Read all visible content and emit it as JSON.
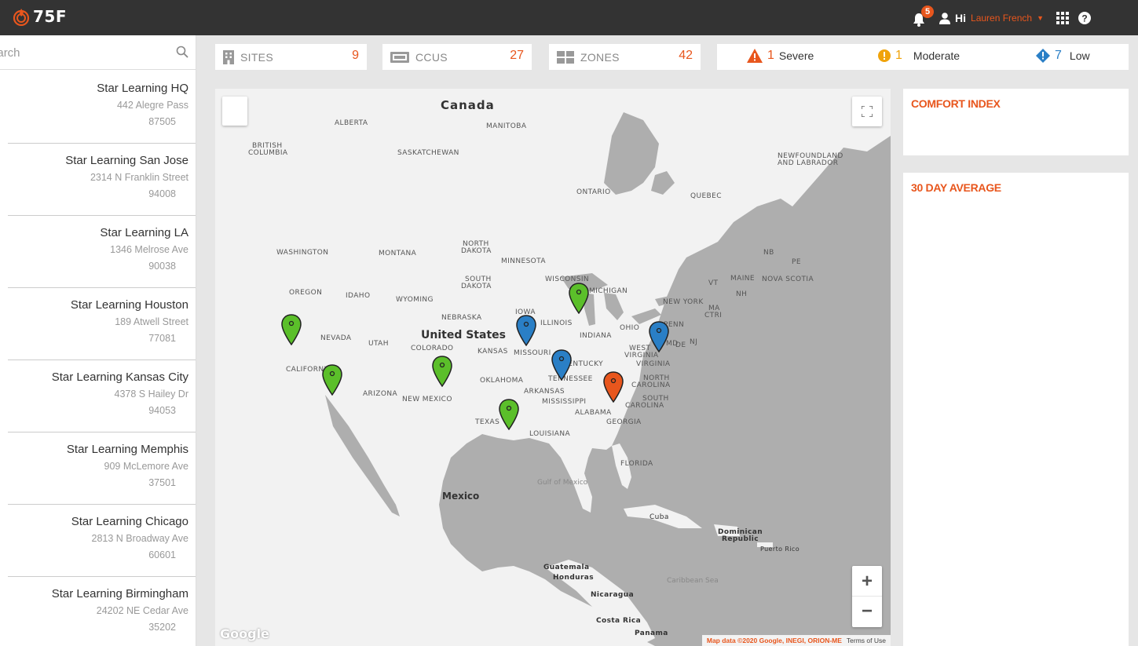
{
  "topbar": {
    "logo_text": "75F",
    "notification_count": "5",
    "greeting": "Hi",
    "user_name": "Lauren French",
    "icons": [
      "bell-icon",
      "user-icon",
      "grid-icon",
      "help-icon"
    ]
  },
  "sidebar": {
    "search_text": "Search",
    "sites": [
      {
        "name": "Star Learning HQ",
        "address": "442  Alegre Pass",
        "zip": "87505"
      },
      {
        "name": "Star Learning San Jose",
        "address": "2314 N  Franklin Street",
        "zip": "94008"
      },
      {
        "name": "Star Learning LA",
        "address": "1346  Melrose Ave",
        "zip": "90038"
      },
      {
        "name": "Star Learning Houston",
        "address": "189  Atwell Street",
        "zip": "77081"
      },
      {
        "name": "Star Learning Kansas City",
        "address": "4378 S  Hailey Dr",
        "zip": "94053"
      },
      {
        "name": "Star Learning Memphis",
        "address": "909 McLemore Ave",
        "zip": "37501"
      },
      {
        "name": "Star Learning Chicago",
        "address": "2813 N Broadway Ave",
        "zip": "60601"
      },
      {
        "name": "Star Learning Birmingham",
        "address": "24202 NE Cedar Ave",
        "zip": "35202"
      }
    ]
  },
  "stats": {
    "sites": {
      "label": "SITES",
      "value": "9"
    },
    "ccus": {
      "label": "CCUS",
      "value": "27"
    },
    "zones": {
      "label": "ZONES",
      "value": "42"
    }
  },
  "alerts": {
    "severe": {
      "count": "1",
      "label": "Severe"
    },
    "moderate": {
      "count": "1",
      "label": "Moderate"
    },
    "low": {
      "count": "7",
      "label": "Low"
    }
  },
  "map": {
    "labels": {
      "canada": "Canada",
      "alberta": "ALBERTA",
      "manitoba": "MANITOBA",
      "british_columbia_1": "BRITISH",
      "british_columbia_2": "COLUMBIA",
      "saskatchewan": "SASKATCHEWAN",
      "newfoundland_1": "NEWFOUNDLAND",
      "newfoundland_2": "AND LABRADOR",
      "ontario": "ONTARIO",
      "quebec": "QUEBEC",
      "washington": "WASHINGTON",
      "montana": "MONTANA",
      "north_dakota_1": "NORTH",
      "north_dakota_2": "DAKOTA",
      "minnesota": "MINNESOTA",
      "nb": "NB",
      "pe": "PE",
      "maine": "MAINE",
      "nova_scotia": "NOVA SCOTIA",
      "vt": "VT",
      "nh": "NH",
      "oregon": "OREGON",
      "idaho": "IDAHO",
      "wyoming": "WYOMING",
      "south_dakota_1": "SOUTH",
      "south_dakota_2": "DAKOTA",
      "wisconsin": "WISCONSIN",
      "michigan": "MICHIGAN",
      "new_york": "NEW YORK",
      "ma": "MA",
      "ctri": "CTRI",
      "iowa": "IOWA",
      "nebraska": "NEBRASKA",
      "illinois": "ILLINOIS",
      "ohio": "OHIO",
      "penn": "PENN",
      "nevada": "NEVADA",
      "utah": "UTAH",
      "united_states": "United States",
      "colorado": "COLORADO",
      "kansas": "KANSAS",
      "missouri": "MISSOURI",
      "indiana": "INDIANA",
      "west_virginia_1": "WEST",
      "west_virginia_2": "VIRGINIA",
      "md": "MD",
      "de": "DE",
      "nj": "NJ",
      "california": "CALIFORNIA",
      "kentucky": "KENTUCKY",
      "virginia": "VIRGINIA",
      "oklahoma": "OKLAHOMA",
      "tennessee": "TENNESSEE",
      "north_carolina_1": "NORTH",
      "north_carolina_2": "CAROLINA",
      "arizona": "ARIZONA",
      "new_mexico": "NEW MEXICO",
      "arkansas": "ARKANSAS",
      "mississippi": "MISSISSIPPI",
      "south_carolina_1": "SOUTH",
      "south_carolina_2": "CAROLINA",
      "alabama": "ALABAMA",
      "georgia": "GEORGIA",
      "texas": "TEXAS",
      "louisiana": "LOUISIANA",
      "florida": "FLORIDA",
      "gulf_of_mexico": "Gulf of Mexico",
      "mexico": "Mexico",
      "cuba": "Cuba",
      "dominican_1": "Dominican",
      "dominican_2": "Republic",
      "puerto_rico": "Puerto Rico",
      "guatemala": "Guatemala",
      "honduras": "Honduras",
      "caribbean_sea": "Caribbean Sea",
      "nicaragua": "Nicaragua",
      "costa_rica": "Costa Rica",
      "panama": "Panama"
    },
    "attribution": "Map data ©2020 Google, INEGI, ORION-ME",
    "terms": "Terms of Use",
    "google": "Google",
    "zoom_in": "+",
    "zoom_out": "−",
    "pin_colors": {
      "green": "#5bbf2a",
      "blue": "#2a7fc6",
      "orange": "#e8561d"
    }
  },
  "panels": {
    "comfort_index": "COMFORT INDEX",
    "thirty_day_average": "30 DAY AVERAGE"
  }
}
